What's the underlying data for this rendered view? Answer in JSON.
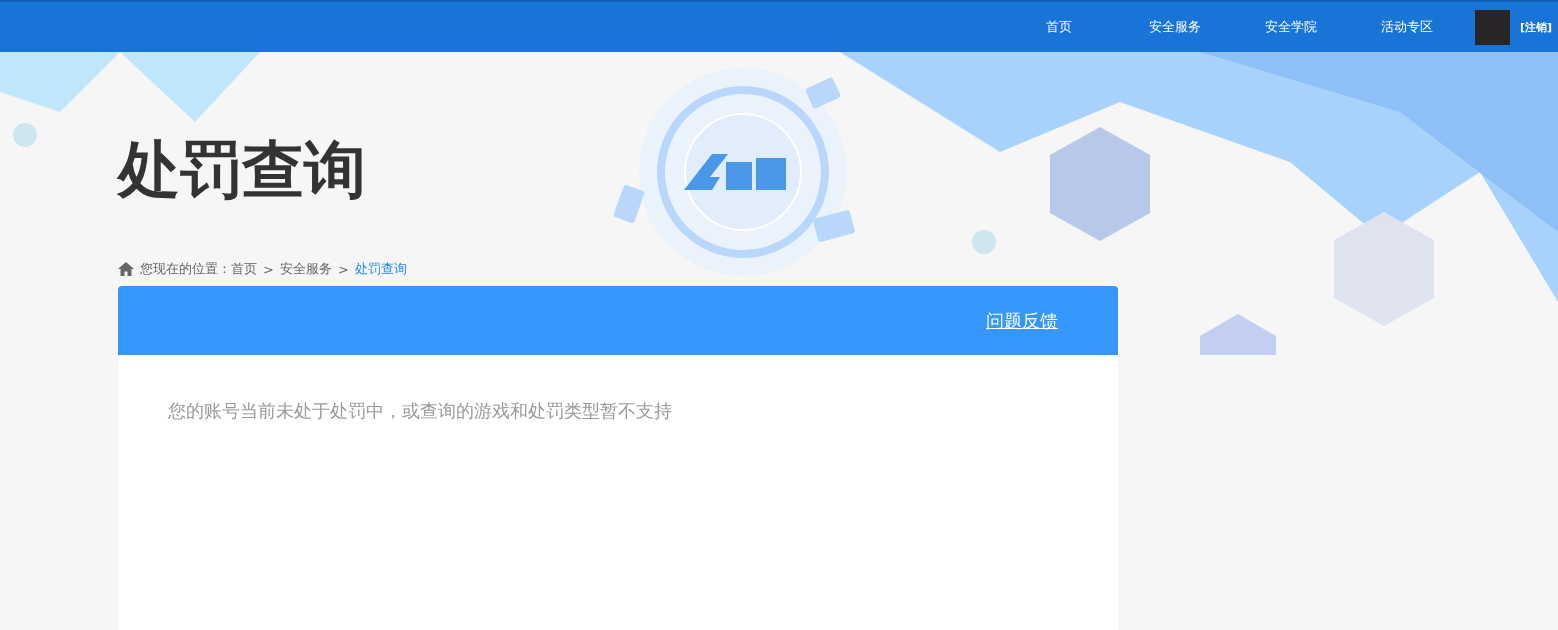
{
  "top_nav": {
    "items": [
      {
        "label": "首页"
      },
      {
        "label": "安全服务"
      },
      {
        "label": "安全学院"
      },
      {
        "label": "活动专区"
      }
    ],
    "logout": "[注销]"
  },
  "page_title": "处罚查询",
  "breadcrumb": {
    "prefix": "您现在的位置：",
    "items": [
      {
        "label": "首页",
        "current": false
      },
      {
        "label": "安全服务",
        "current": false
      },
      {
        "label": "处罚查询",
        "current": true
      }
    ],
    "separator": ">"
  },
  "panel": {
    "header_link": "问题反馈",
    "message": "您的账号当前未处于处罚中，或查询的游戏和处罚类型暂不支持"
  }
}
